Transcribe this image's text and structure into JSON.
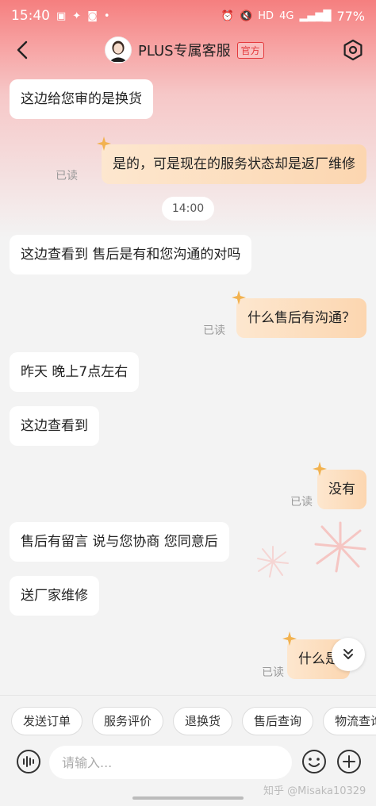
{
  "status_bar": {
    "time": "15:40",
    "network": "4G",
    "signal_label": "HD",
    "battery": "77%"
  },
  "header": {
    "title": "PLUS专属客服",
    "badge": "官方"
  },
  "messages": [
    {
      "side": "left",
      "text": "这边给您审的是换货"
    },
    {
      "side": "right",
      "text": "是的，可是现在的服务状态却是返厂维修",
      "read": "已读"
    },
    {
      "side": "time",
      "text": "14:00"
    },
    {
      "side": "left",
      "text": "这边查看到 售后是有和您沟通的对吗"
    },
    {
      "side": "right",
      "text": "什么售后有沟通？",
      "read": "已读"
    },
    {
      "side": "left",
      "text": "昨天  晚上7点左右"
    },
    {
      "side": "left",
      "text": "这边查看到"
    },
    {
      "side": "right",
      "text": "没有",
      "read": "已读"
    },
    {
      "side": "left",
      "text": "售后有留言 说与您协商 您同意后"
    },
    {
      "side": "left",
      "text": "送厂家维修"
    },
    {
      "side": "right",
      "text": "什么是",
      "read": "已读"
    }
  ],
  "quick_actions": [
    "发送订单",
    "服务评价",
    "退换货",
    "售后查询",
    "物流查询"
  ],
  "input": {
    "placeholder": "请输入..."
  },
  "watermark": "知乎 @Misaka10329",
  "colors": {
    "accent_red": "#e4393c",
    "header_gradient_top": "#f57f7f",
    "right_bubble": "#fcd6b0",
    "background": "#f3f3f3"
  },
  "icons": [
    "back-icon",
    "settings-icon",
    "chevron-double-down-icon",
    "voice-icon",
    "emoji-icon",
    "plus-icon"
  ]
}
